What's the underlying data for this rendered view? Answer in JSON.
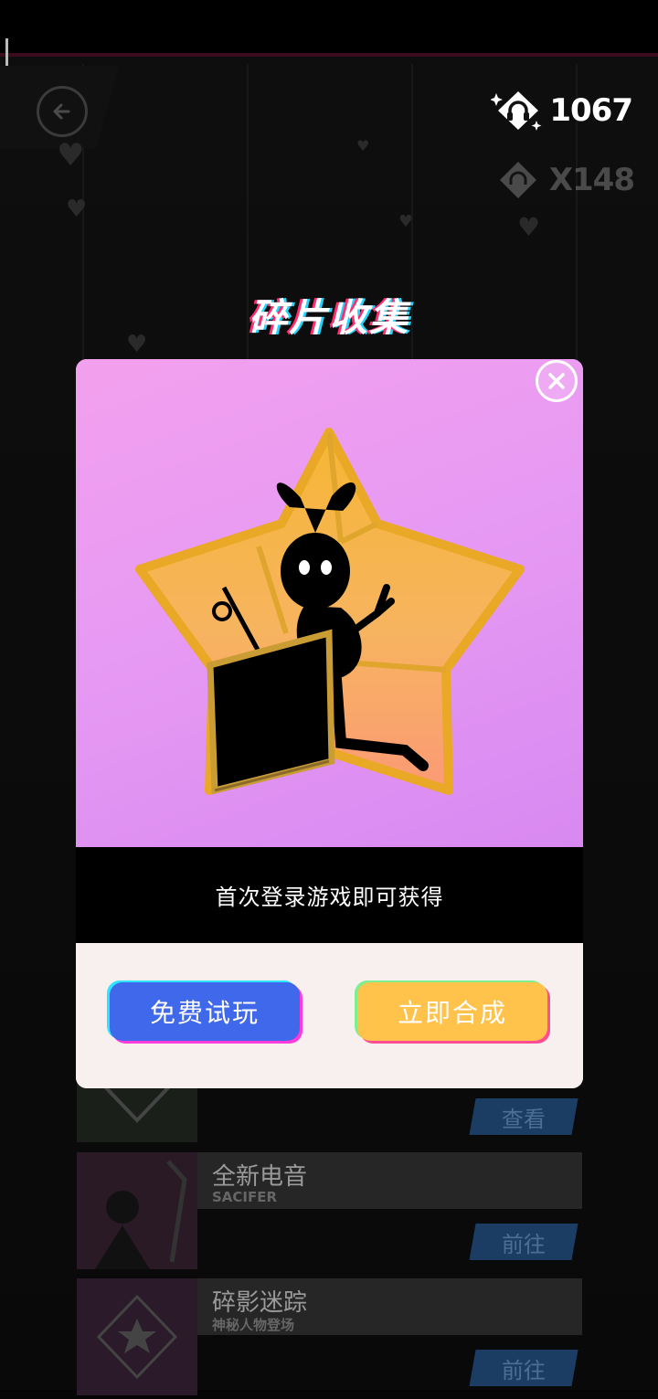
{
  "header": {
    "currency_value": "1067",
    "multiplier_value": "X148"
  },
  "page_title": "碎片收集",
  "modal": {
    "caption": "首次登录游戏即可获得",
    "trial_label": "免费试玩",
    "compose_label": "立即合成"
  },
  "cards": [
    {
      "button_label": "查看"
    },
    {
      "title": "全新电音",
      "subtitle": "SACIFER",
      "button_label": "前往"
    },
    {
      "title": "碎影迷踪",
      "subtitle": "神秘人物登场",
      "button_label": "前往"
    }
  ],
  "icons": [
    "back-arrow-icon",
    "headphones-token-icon",
    "sparkle-icon",
    "close-icon",
    "heart-icon",
    "star-shard-icon"
  ],
  "colors": {
    "modal_art": "#e79af3",
    "trial_button": "#4068ea",
    "compose_button": "#ffc24a",
    "star_gold": "#f2b63a"
  }
}
